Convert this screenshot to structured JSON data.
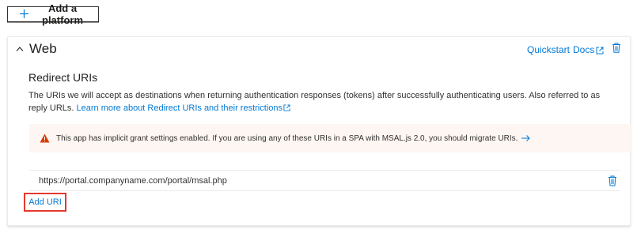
{
  "toolbar": {
    "add_platform_label": "Add a platform"
  },
  "platform_card": {
    "title": "Web",
    "quickstart_label": "Quickstart",
    "docs_label": "Docs",
    "section_title": "Redirect URIs",
    "description": "The URIs we will accept as destinations when returning authentication responses (tokens) after successfully authenticating users. Also referred to as reply URLs.",
    "learn_more_link": "Learn more about Redirect URIs and their restrictions",
    "warning_text": "This app has implicit grant settings enabled. If you are using any of these URIs in a SPA with MSAL.js 2.0, you should migrate URIs.",
    "uris": [
      "https://portal.companyname.com/portal/msal.php"
    ],
    "add_uri_label": "Add URI"
  },
  "colors": {
    "link": "#0078d4",
    "warning_icon": "#d83b01",
    "warning_bg": "#fdf6f3",
    "highlight_border": "#e5392e"
  },
  "icons": {
    "add_platform": "plus-icon",
    "collapse": "chevron-up-icon",
    "docs": "external-link-icon",
    "delete": "trash-icon",
    "warning": "warning-icon",
    "warning_action": "arrow-right-icon"
  }
}
